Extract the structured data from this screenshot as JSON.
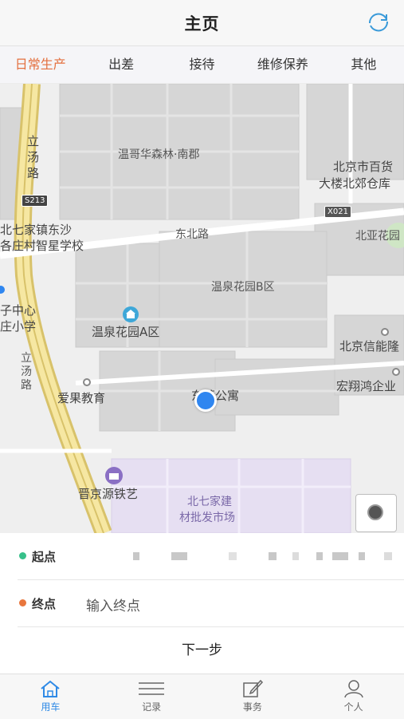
{
  "header": {
    "title": "主页",
    "refresh_icon": "refresh-icon"
  },
  "tabs": [
    {
      "label": "日常生产",
      "active": true
    },
    {
      "label": "出差",
      "active": false
    },
    {
      "label": "接待",
      "active": false
    },
    {
      "label": "维修保养",
      "active": false
    },
    {
      "label": "其他",
      "active": false
    }
  ],
  "map": {
    "labels": {
      "litang_road_1": "立\n汤\n路",
      "wenge": "温哥华森林·南郡",
      "beijing_baihuo": "北京市百货",
      "dalou": "大楼北郊仓库",
      "beiqijia_dongsha": "北七家镇东沙",
      "gezhuang_school": "各庄村智星学校",
      "dongbei_road": "东北路",
      "beiya": "北亚花园",
      "wenquan_b": "温泉花园B区",
      "center_school_1": "子中心",
      "center_school_2": "庄小学",
      "wenquan_a": "温泉花园A区",
      "beijing_xinneng": "北京信能隆",
      "litang_road_2": "立\n汤\n路",
      "hongxiang": "宏翔鸿企业",
      "aiguo": "爱果教育",
      "gongyu": "东苹公寓",
      "jingyuan": "晋京源铁艺",
      "market_1": "北七家建",
      "market_2": "材批发市场"
    },
    "shields": {
      "s213": "S213",
      "x021": "X021"
    }
  },
  "form": {
    "start_label": "起点",
    "start_color": "#37c08a",
    "end_label": "终点",
    "end_color": "#e8763d",
    "end_placeholder": "输入终点",
    "next_label": "下一步"
  },
  "tabbar": [
    {
      "label": "用车",
      "icon": "home-icon",
      "active": true
    },
    {
      "label": "记录",
      "icon": "list-icon",
      "active": false
    },
    {
      "label": "事务",
      "icon": "edit-icon",
      "active": false
    },
    {
      "label": "个人",
      "icon": "person-icon",
      "active": false
    }
  ],
  "colors": {
    "accent": "#e4703f",
    "tab_active": "#2f8ae6",
    "location": "#2f86f0"
  }
}
